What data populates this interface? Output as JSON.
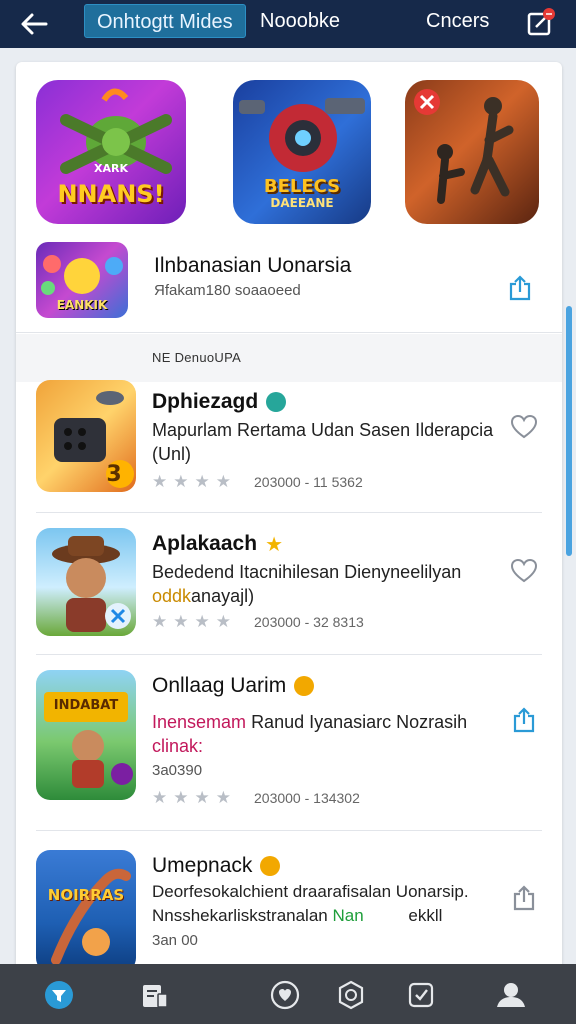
{
  "header": {
    "tabs": [
      {
        "label": "Onhtogtt Mides",
        "active": true
      },
      {
        "label": "Nooobke",
        "active": false
      },
      {
        "label": "Cncers",
        "active": false
      }
    ]
  },
  "featured": [
    {
      "name": "game-icon-nnans",
      "label": "NNANS!",
      "sub": "XARK"
    },
    {
      "name": "game-icon-beleecs",
      "label": "BELECS",
      "sub": "DAEEANE"
    },
    {
      "name": "game-icon-soldier",
      "label": ""
    }
  ],
  "promoted": {
    "title": "Ilnbanasian Uonarsia",
    "subtitle": "Яfakam180 soaaoeed",
    "icon_label": "EANKIK"
  },
  "section": {
    "label": "NE DenuoUPA"
  },
  "items": [
    {
      "title": "Dphiezagd",
      "desc": "Mapurlam Rertama Udan Sasen Ilderapcia (Unl)",
      "meta": "203000 - 11 5362",
      "action": "heart",
      "icon_label": "3"
    },
    {
      "title": "Aplakaach",
      "desc_part1": "Bededend Itacnihilesan Dienyneelilyan",
      "desc_part2_colored": "oddk",
      "desc_part3": "anayajl)",
      "meta": "203000 - 32 8313",
      "action": "heart"
    },
    {
      "title": "Onllaag Uarim",
      "desc_part1_colored": "Inensemam",
      "desc_part2": "Ranud Iyanasiarc Nozrasih",
      "desc_part3_colored": "clinak:",
      "extra": "3a0390",
      "meta": "203000 - 134302",
      "action": "share",
      "icon_label": "INDABAT"
    },
    {
      "title": "Umepnack",
      "desc_part1": "Deorfesokalchient draarafisalan Uonarsip.",
      "desc_part2": "Nnsshekarliskstranalan",
      "desc_part3_colored": "Nan",
      "desc_part4": "ekkll",
      "extra": "3an 00",
      "action": "share",
      "icon_label": "NOIRRAS"
    }
  ],
  "bottom_nav": [
    "filter-icon",
    "device-icon",
    "shield-heart-icon",
    "badge-icon",
    "check-shield-icon",
    "user-icon"
  ],
  "colors": {
    "topbar": "#16294a",
    "active_tab": "#1f6f9c",
    "accent_blue": "#2a9ad6",
    "pink_text": "#c2185b",
    "green_text": "#1e9e3a",
    "orange_text": "#c98a00",
    "bottom_nav": "#3d4148"
  }
}
